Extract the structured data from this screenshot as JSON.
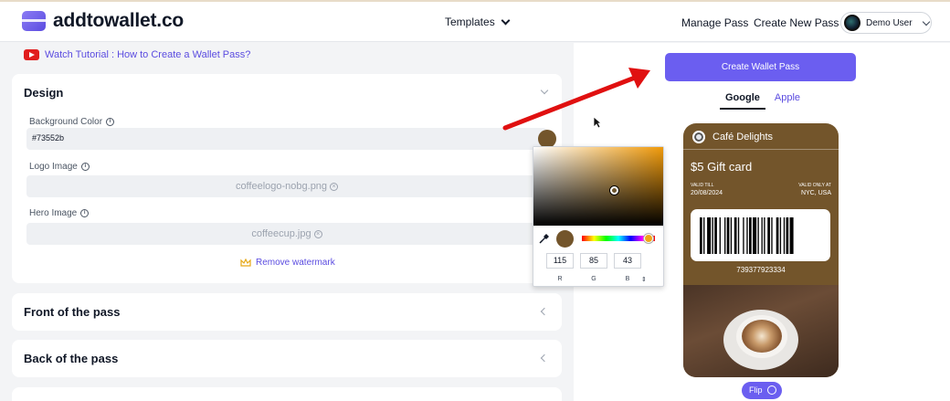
{
  "header": {
    "logo_text": "addtowallet.co",
    "nav_templates": "Templates",
    "nav_manage": "Manage Pass",
    "nav_create": "Create New Pass",
    "user_name": "Demo User"
  },
  "tutorial": {
    "label": "Watch Tutorial : How to Create a Wallet Pass?"
  },
  "design": {
    "title": "Design",
    "background_color": {
      "label": "Background Color",
      "value": "#73552b",
      "swatch_color": "#73552b"
    },
    "logo_image": {
      "label": "Logo Image",
      "file": "coffeelogo-nobg.png"
    },
    "hero_image": {
      "label": "Hero Image",
      "file": "coffeecup.jpg"
    },
    "remove_watermark": "Remove watermark"
  },
  "sections": {
    "front": "Front of the pass",
    "back": "Back of the pass"
  },
  "color_picker": {
    "r": "115",
    "g": "85",
    "b": "43",
    "r_label": "R",
    "g_label": "G",
    "b_label": "B",
    "mode_toggle": "⇕"
  },
  "preview": {
    "create_button": "Create Wallet Pass",
    "tab_google": "Google",
    "tab_apple": "Apple",
    "pass": {
      "brand": "Café Delights",
      "title": "$5 Gift card",
      "valid_till_label": "VALID TILL",
      "valid_till_value": "20/08/2024",
      "valid_only_label": "VALID ONLY AT",
      "valid_only_value": "NYC, USA",
      "barcode_number": "739377923334"
    },
    "flip_button": "Flip"
  },
  "colors": {
    "accent": "#6b5ef0",
    "pass_background": "#73552b",
    "youtube_red": "#e11d1d",
    "annotation_arrow": "#e01010"
  }
}
